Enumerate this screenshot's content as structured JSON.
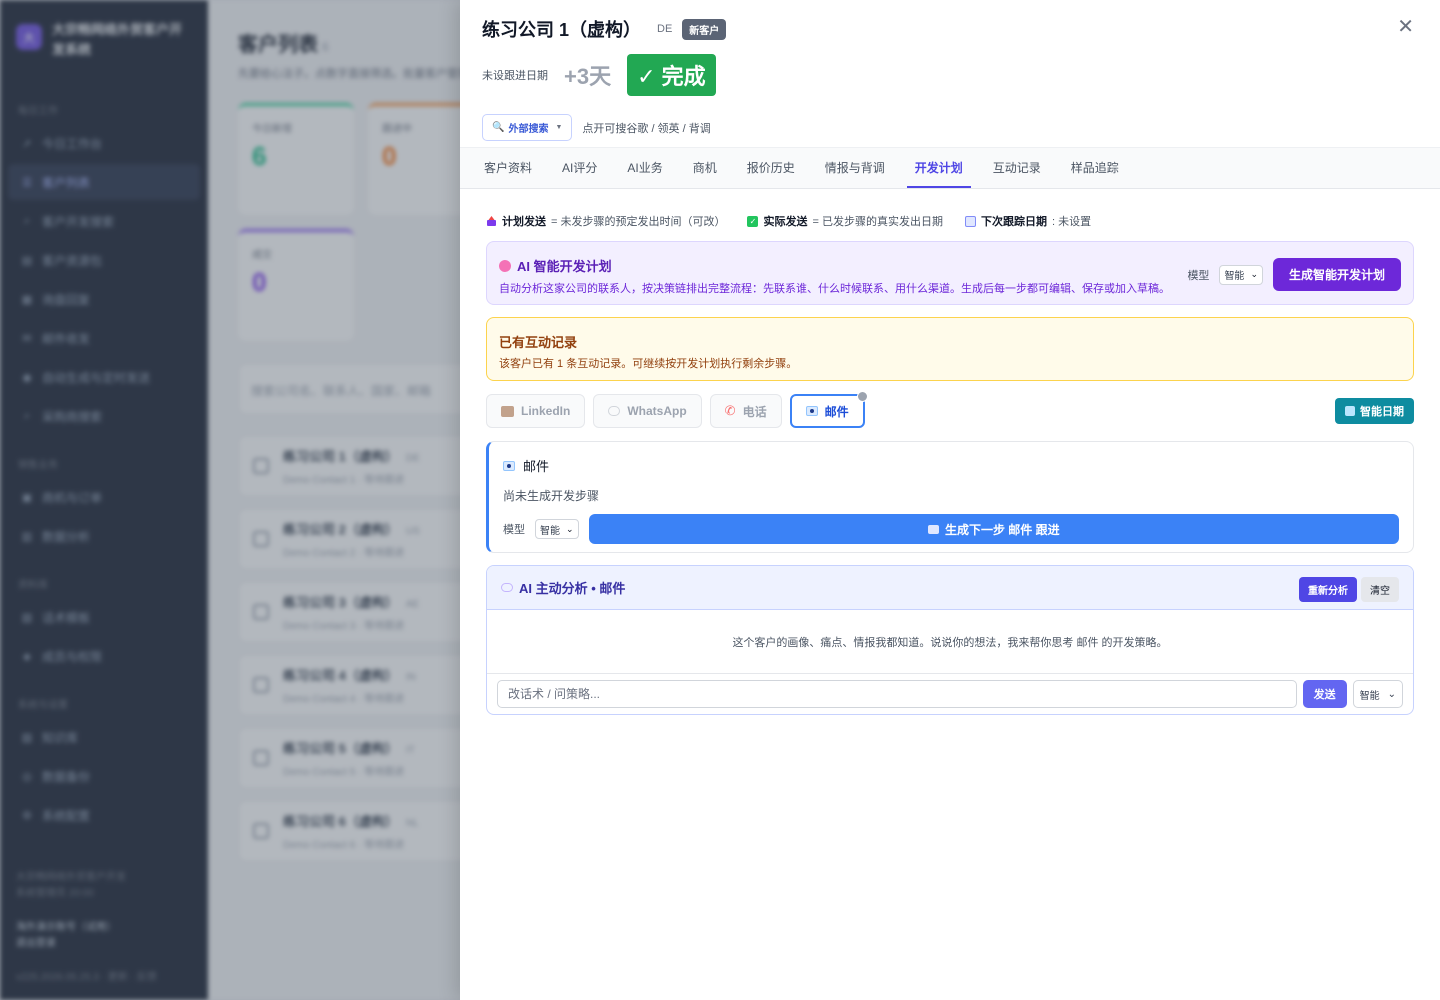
{
  "sidebar": {
    "brand": "大宗畅网络外贸客户开发系统",
    "logo": "大",
    "sections": [
      {
        "title": "每日工作",
        "items": [
          {
            "label": "今日工作台",
            "icon": "rocket-icon"
          },
          {
            "label": "客户列表",
            "icon": "list-icon",
            "active": true
          },
          {
            "label": "客户开发搜索",
            "icon": "search-icon"
          },
          {
            "label": "客户资源包",
            "icon": "folder-icon"
          },
          {
            "label": "询盘回复",
            "icon": "calendar-icon"
          },
          {
            "label": "邮件收发",
            "icon": "mail-icon"
          },
          {
            "label": "自动生成与定时发送",
            "icon": "robot-icon"
          },
          {
            "label": "采购商搜索",
            "icon": "magnifier-icon"
          }
        ]
      },
      {
        "title": "销售业务",
        "items": [
          {
            "label": "商机与订单",
            "icon": "briefcase-icon"
          },
          {
            "label": "数据分析",
            "icon": "chart-icon"
          }
        ]
      },
      {
        "title": "资料库",
        "items": [
          {
            "label": "话术模板",
            "icon": "clipboard-icon"
          },
          {
            "label": "成员与权限",
            "icon": "shield-icon"
          }
        ]
      },
      {
        "title": "系统与设置",
        "items": [
          {
            "label": "知识库",
            "icon": "books-icon"
          },
          {
            "label": "数据备份",
            "icon": "database-icon"
          },
          {
            "label": "系统配置",
            "icon": "gear-icon"
          }
        ]
      }
    ],
    "footer": {
      "line1": "大宗畅网络外贸客户开发",
      "line2": "系统管理员 20:00",
      "line3": "海外演示账号（试用）",
      "line4": "退出登录",
      "version": "v225.2026.05.25.3 · 更新 · 反馈"
    }
  },
  "main_bg": {
    "title": "客户列表",
    "count": "6",
    "subtitle": "先要给心法子。点数字直接筛选。批量客户管理",
    "stats": [
      {
        "label": "今日新增",
        "value": "6"
      },
      {
        "label": "跟进中",
        "value": "0"
      },
      {
        "label": "成交",
        "value": "0"
      }
    ],
    "search_placeholder": "搜索公司名、联系人、国家、邮箱",
    "rows": [
      {
        "name": "练习公司 1（虚构）",
        "country": "DE",
        "contact": "Demo Contact 1 · 等待跟进"
      },
      {
        "name": "练习公司 2（虚构）",
        "country": "US",
        "contact": "Demo Contact 2 · 等待跟进"
      },
      {
        "name": "练习公司 3（虚构）",
        "country": "AE",
        "contact": "Demo Contact 3 · 等待跟进"
      },
      {
        "name": "练习公司 4（虚构）",
        "country": "IN",
        "contact": "Demo Contact 4 · 等待跟进"
      },
      {
        "name": "练习公司 5（虚构）",
        "country": "IT",
        "contact": "Demo Contact 5 · 等待跟进"
      },
      {
        "name": "练习公司 6（虚构）",
        "country": "NL",
        "contact": "Demo Contact 6 · 等待跟进"
      }
    ]
  },
  "drawer": {
    "title": "练习公司 1（虚构）",
    "country": "DE",
    "badge": "新客户",
    "close": "✕",
    "followup_label": "未设跟进日期",
    "followup_plus": "+3天",
    "done_button": "✓ 完成",
    "ext_search": {
      "icon": "🔍",
      "label": "外部搜索",
      "caret": "▼"
    },
    "ext_hint": "点开可搜谷歌 / 领英 / 背调",
    "tabs": [
      {
        "label": "客户资料"
      },
      {
        "label": "AI评分"
      },
      {
        "label": "AI业务"
      },
      {
        "label": "商机"
      },
      {
        "label": "报价历史"
      },
      {
        "label": "情报与背调"
      },
      {
        "label": "开发计划",
        "active": true
      },
      {
        "label": "互动记录"
      },
      {
        "label": "样品追踪"
      }
    ],
    "legend": {
      "planned_bold": "计划发送",
      "planned_text": "= 未发步骤的预定发出时间（可改）",
      "actual_bold": "实际发送",
      "actual_text": "= 已发步骤的真实发出日期",
      "next_bold": "下次跟踪日期",
      "next_text": ": 未设置"
    },
    "ai_plan": {
      "title": "AI 智能开发计划",
      "desc": "自动分析这家公司的联系人，按决策链排出完整流程：先联系谁、什么时候联系、用什么渠道。生成后每一步都可编辑、保存或加入草稿。",
      "model_label": "模型",
      "model_value": "智能",
      "button": "生成智能开发计划"
    },
    "notice": {
      "title": "已有互动记录",
      "desc": "该客户已有 1 条互动记录。可继续按开发计划执行剩余步骤。"
    },
    "channels": [
      {
        "label": "LinkedIn",
        "icon": "briefcase-icon"
      },
      {
        "label": "WhatsApp",
        "icon": "chat-bubble-icon"
      },
      {
        "label": "电话",
        "icon": "phone-icon"
      },
      {
        "label": "邮件",
        "icon": "envelope-icon",
        "active": true
      }
    ],
    "smart_date": "智能日期",
    "email_panel": {
      "title": "邮件",
      "empty": "尚未生成开发步骤",
      "model_label": "模型",
      "model_value": "智能",
      "button": "生成下一步 邮件 跟进"
    },
    "ai_analysis": {
      "title": "AI 主动分析 • 邮件",
      "reanalyze": "重新分析",
      "clear": "清空",
      "body": "这个客户的画像、痛点、情报我都知道。说说你的想法，我来帮你思考 邮件 的开发策略。",
      "input_placeholder": "改话术 / 问策略...",
      "send": "发送",
      "model_value": "智能"
    }
  },
  "colors": {
    "accent": "#4f46e5",
    "done_green": "#22a853",
    "plan_purple": "#6d28d9",
    "email_blue": "#3b82f6",
    "smart_date_teal": "#0e8ca0"
  }
}
